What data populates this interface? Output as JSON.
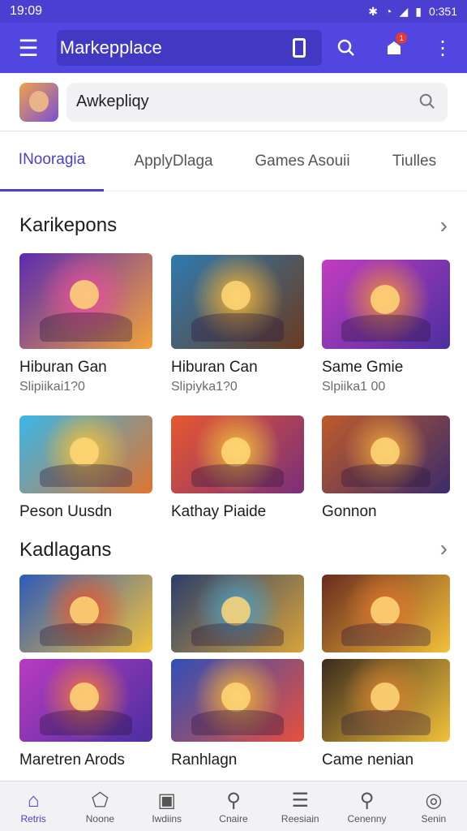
{
  "status": {
    "time": "19:09",
    "right_time": "0:351",
    "icons": [
      "bluetooth-icon",
      "wifi-icon",
      "signal-icon",
      "battery-icon"
    ]
  },
  "appbar": {
    "title": "Markepplace",
    "notif_count": "1"
  },
  "search": {
    "value": "Awkepliqy"
  },
  "tabs": [
    {
      "label": "INooragia",
      "active": true
    },
    {
      "label": "ApplyDlaga",
      "active": false
    },
    {
      "label": "Games Asouii",
      "active": false
    },
    {
      "label": "Tiulles",
      "active": false
    }
  ],
  "sections": [
    {
      "title": "Karikepons"
    },
    {
      "title": "Kadlagans"
    }
  ],
  "cards": [
    {
      "name": "Hiburan Gan",
      "sub": "Slipiikai1?0",
      "colors": [
        "#5a2bb0",
        "#e94f9b",
        "#f4a33b"
      ]
    },
    {
      "name": "Hiburan Can",
      "sub": "Slipiyka1?0",
      "colors": [
        "#2f7ab0",
        "#f2b53a",
        "#6a3b1f"
      ]
    },
    {
      "name": "Same Gmie",
      "sub": "Slpiika1 00",
      "colors": [
        "#c33cc0",
        "#f58f3c",
        "#4b2fa0"
      ]
    },
    {
      "name": "Peson Uusdn",
      "sub": "",
      "colors": [
        "#39b6e8",
        "#f3c33b",
        "#e0742f"
      ]
    },
    {
      "name": "Kathay Piaide",
      "sub": "",
      "colors": [
        "#e8582f",
        "#f2c13a",
        "#7a2f7a"
      ]
    },
    {
      "name": "Gonnon",
      "sub": "",
      "colors": [
        "#c05a2b",
        "#f2a73a",
        "#3b2b6a"
      ]
    },
    {
      "name": "",
      "sub": "",
      "colors": [
        "#2f5ab8",
        "#e8582f",
        "#f4c33a"
      ]
    },
    {
      "name": "",
      "sub": "",
      "colors": [
        "#2a3f6b",
        "#4da0c8",
        "#d8a33a"
      ]
    },
    {
      "name": "",
      "sub": "",
      "colors": [
        "#6a2b1f",
        "#e0742f",
        "#f2c13a"
      ]
    },
    {
      "name": "Maretren Arods",
      "sub": "",
      "colors": [
        "#b93ac0",
        "#f27b3c",
        "#4b2fa0"
      ]
    },
    {
      "name": "Ranhlagn",
      "sub": "",
      "colors": [
        "#2f4fb8",
        "#f2b53a",
        "#e84f3c"
      ]
    },
    {
      "name": "Came nenian",
      "sub": "",
      "colors": [
        "#3b2b1f",
        "#d8832f",
        "#f2c13a"
      ]
    }
  ],
  "bottom_nav": [
    {
      "label": "Retris",
      "icon": "home-icon",
      "active": true
    },
    {
      "label": "Noone",
      "icon": "store-icon",
      "active": false
    },
    {
      "label": "Iwdiins",
      "icon": "gamepad-icon",
      "active": false
    },
    {
      "label": "Cnaire",
      "icon": "search-icon",
      "active": false
    },
    {
      "label": "Reesiain",
      "icon": "list-icon",
      "active": false
    },
    {
      "label": "Cenenny",
      "icon": "search-icon",
      "active": false
    },
    {
      "label": "Senin",
      "icon": "profile-icon",
      "active": false
    }
  ]
}
